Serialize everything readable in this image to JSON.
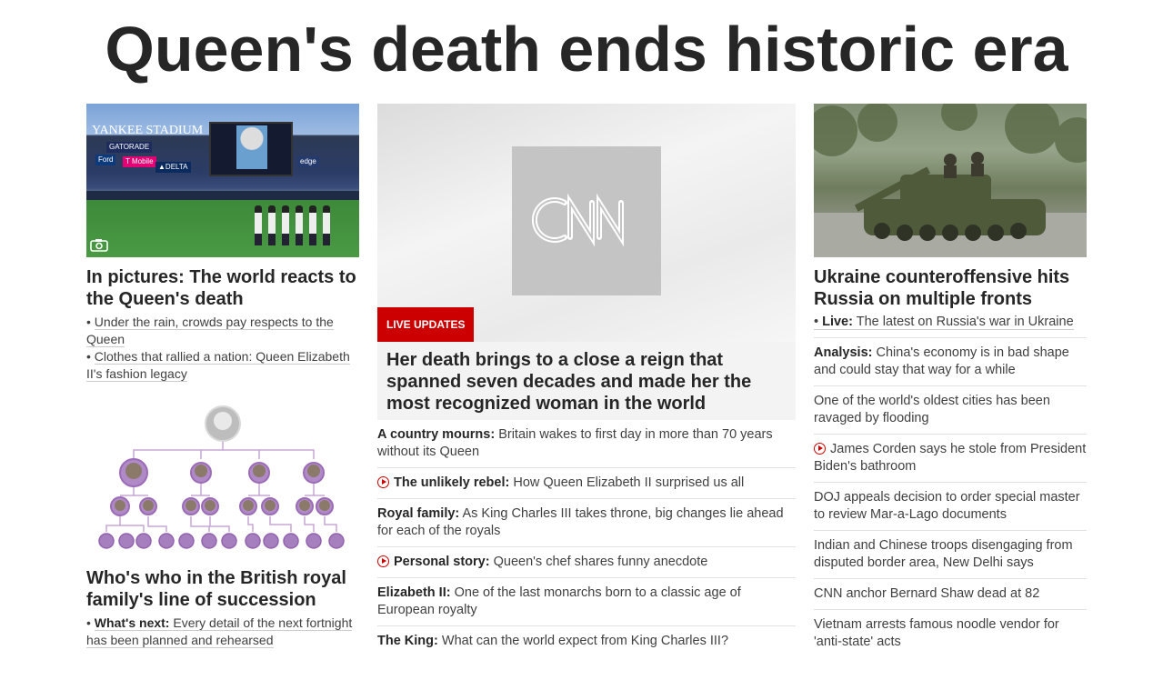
{
  "headline": "Queen's death ends historic era",
  "left": {
    "photo_icon": "camera-icon",
    "stadium_texts": {
      "yankee": "YANKEE STADIUM",
      "gatorade": "GATORADE",
      "tmobile": "T Mobile",
      "delta": "▲DELTA",
      "ford": "Ford",
      "edge": "edge"
    },
    "story1_title": "In pictures: The world reacts to the Queen's death",
    "story1_links": [
      "Under the rain, crowds pay respects to the Queen",
      "Clothes that rallied a nation: Queen Elizabeth II's fashion legacy"
    ],
    "story2_title": "Who's who in the British royal family's line of succession",
    "story2_link_label": "What's next:",
    "story2_link_text": "Every detail of the next fortnight has been planned and rehearsed"
  },
  "middle": {
    "badge": "LIVE UPDATES",
    "title": "Her death brings to a close a reign that spanned seven decades and made her the most recognized woman in the world",
    "items": [
      {
        "label": "A country mourns:",
        "text": "Britain wakes to first day in more than 70 years without its Queen",
        "video": false
      },
      {
        "label": "The unlikely rebel:",
        "text": "How Queen Elizabeth II surprised us all",
        "video": true
      },
      {
        "label": "Royal family:",
        "text": "As King Charles III takes throne, big changes lie ahead for each of the royals",
        "video": false
      },
      {
        "label": "Personal story:",
        "text": "Queen's chef shares funny anecdote",
        "video": true
      },
      {
        "label": "Elizabeth II:",
        "text": "One of the last monarchs born to a classic age of European royalty",
        "video": false
      },
      {
        "label": "The King:",
        "text": "What can the world expect from King Charles III?",
        "video": false
      }
    ]
  },
  "right": {
    "title": "Ukraine counteroffensive hits Russia on multiple fronts",
    "live_label": "Live:",
    "live_text": "The latest on Russia's war in Ukraine",
    "items": [
      {
        "label": "Analysis:",
        "text": "China's economy is in bad shape and could stay that way for a while",
        "video": false
      },
      {
        "label": "",
        "text": "One of the world's oldest cities has been ravaged by flooding",
        "video": false
      },
      {
        "label": "",
        "text": "James Corden says he stole from President Biden's bathroom",
        "video": true
      },
      {
        "label": "",
        "text": "DOJ appeals decision to order special master to review Mar-a-Lago documents",
        "video": false
      },
      {
        "label": "",
        "text": "Indian and Chinese troops disengaging from disputed border area, New Delhi says",
        "video": false
      },
      {
        "label": "",
        "text": "CNN anchor Bernard Shaw dead at 82",
        "video": false
      },
      {
        "label": "",
        "text": "Vietnam arrests famous noodle vendor for 'anti-state' acts",
        "video": false
      }
    ]
  }
}
